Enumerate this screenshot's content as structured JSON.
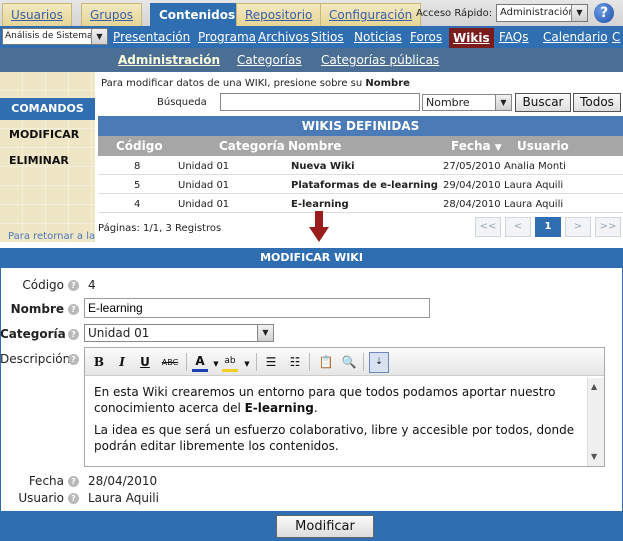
{
  "top_tabs": [
    "Usuarios",
    "Grupos",
    "Contenidos",
    "Repositorio",
    "Configuración"
  ],
  "quick_access": {
    "label": "Acceso Rápido:",
    "value": "Administración"
  },
  "help_label": "?",
  "site_select": "Análisis de Sistemas",
  "nav2": [
    "Presentación",
    "Programa",
    "Archivos",
    "Sitios",
    "Noticias",
    "Foros",
    "Wikis",
    "FAQs",
    "Calendario",
    "C"
  ],
  "nav3": [
    "Administración",
    "Categorías",
    "Categorías públicas"
  ],
  "sidebar": {
    "heading": "COMANDOS",
    "items": [
      "MODIFICAR",
      "ELIMINAR"
    ],
    "return_link": "Para retornar a la"
  },
  "hint": {
    "prefix": "Para modificar datos de una WIKI, presione sobre su ",
    "bold": "Nombre"
  },
  "search": {
    "label": "Búsqueda",
    "value": "",
    "field": "Nombre",
    "search_btn": "Buscar",
    "all_btn": "Todos"
  },
  "wikis": {
    "heading": "WIKIS DEFINIDAS",
    "columns": [
      "Código",
      "Categoría",
      "Nombre",
      "Fecha",
      "Usuario"
    ],
    "sort_indicator": "▼",
    "rows": [
      {
        "codigo": "8",
        "categoria": "Unidad 01",
        "nombre": "Nueva Wiki",
        "fecha": "27/05/2010",
        "usuario": "Analia Monti"
      },
      {
        "codigo": "5",
        "categoria": "Unidad 01",
        "nombre": "Plataformas de e-learning",
        "fecha": "29/04/2010",
        "usuario": "Laura Aquili"
      },
      {
        "codigo": "4",
        "categoria": "Unidad 01",
        "nombre": "E-learning",
        "fecha": "28/04/2010",
        "usuario": "Laura Aquili"
      }
    ],
    "pages_label": "Páginas: 1/1, 3 Registros",
    "pager": [
      "<<",
      "<",
      "1",
      ">",
      ">>"
    ]
  },
  "modify": {
    "heading": "MODIFICAR WIKI",
    "labels": {
      "codigo": "Código",
      "nombre": "Nombre",
      "categoria": "Categoría",
      "descripcion": "Descripción",
      "fecha": "Fecha",
      "usuario": "Usuario"
    },
    "codigo": "4",
    "nombre": "E-learning",
    "categoria": "Unidad 01",
    "description": {
      "p1_text": "En esta Wiki crearemos un entorno para que todos podamos aportar nuestro conocimiento acerca del ",
      "p1_bold": "E-learning",
      "p1_end": ".",
      "p2": "La idea es que será un esfuerzo colaborativo, libre y accesible por todos, donde podrán editar libremente los contenidos."
    },
    "fecha": "28/04/2010",
    "usuario": "Laura Aquili",
    "submit": "Modificar"
  },
  "toolbar_icons": [
    "bold-icon",
    "italic-icon",
    "underline-icon",
    "strikethrough-icon",
    "font-color-icon",
    "highlight-icon",
    "bullet-list-icon",
    "numbered-list-icon",
    "paste-icon",
    "find-icon",
    "source-icon"
  ],
  "colors": {
    "primary_blue": "#2f6eb1",
    "tab_tan": "#e5d596",
    "arrow_red": "#9b1c1c"
  }
}
